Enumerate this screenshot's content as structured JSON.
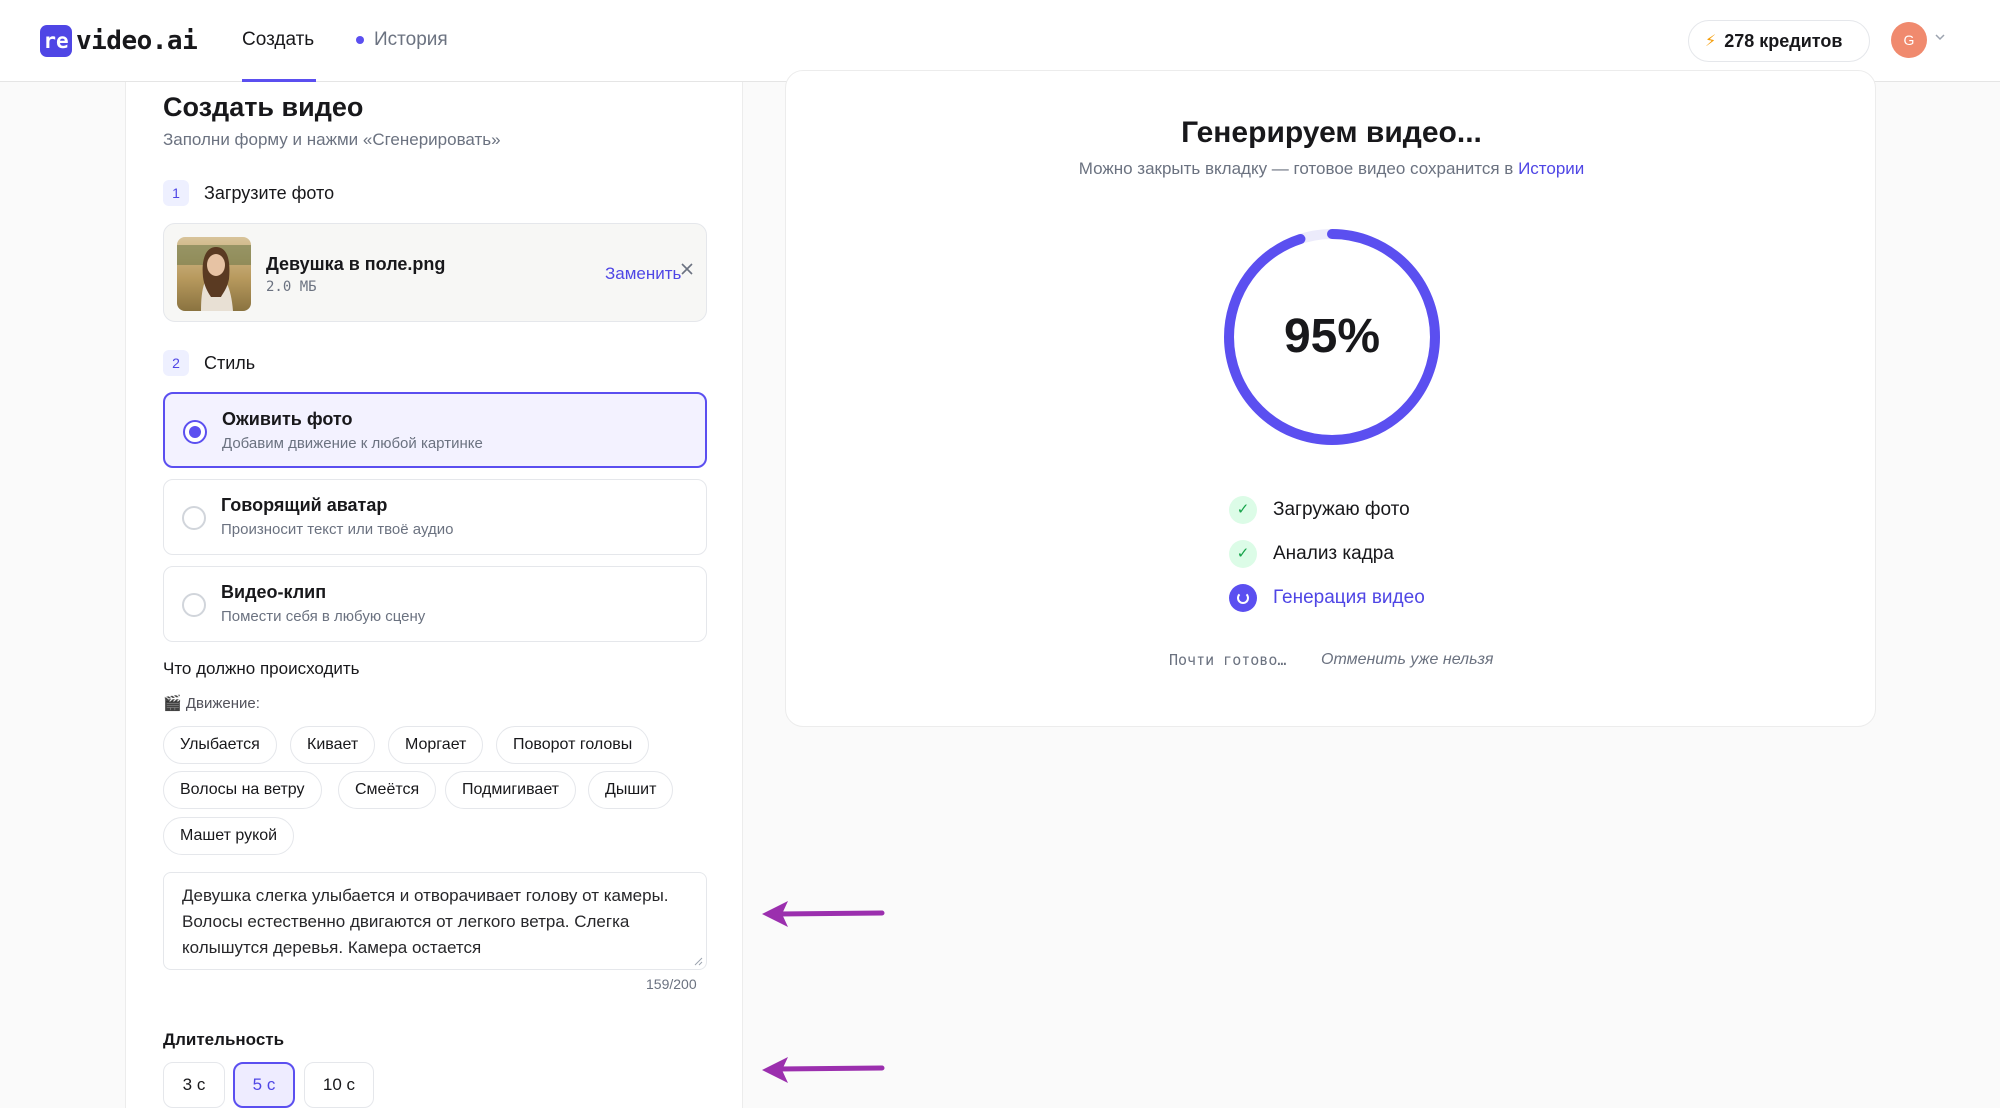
{
  "header": {
    "logo_mark": "re",
    "logo_text": "video.ai",
    "nav": [
      {
        "label": "Создать",
        "active": true
      },
      {
        "label": "История",
        "active": false
      }
    ],
    "credits": "278 кредитов",
    "avatar_initial": "G"
  },
  "form": {
    "title": "Создать видео",
    "subtitle": "Заполни форму и нажми «Сгенерировать»",
    "step1": {
      "number": "1",
      "label": "Загрузите фото"
    },
    "file": {
      "name": "Девушка в поле.png",
      "size": "2.0 МБ",
      "replace_label": "Заменить"
    },
    "step2": {
      "number": "2",
      "label": "Стиль"
    },
    "styles": [
      {
        "title": "Оживить фото",
        "desc": "Добавим движение к любой картинке",
        "selected": true
      },
      {
        "title": "Говорящий аватар",
        "desc": "Произносит текст или твоё аудио",
        "selected": false
      },
      {
        "title": "Видео-клип",
        "desc": "Помести себя в любую сцену",
        "selected": false
      }
    ],
    "prompt_label": "Что должно происходить",
    "motion_label": "🎬 Движение:",
    "chips": [
      "Улыбается",
      "Кивает",
      "Моргает",
      "Поворот головы",
      "Волосы на ветру",
      "Смеётся",
      "Подмигивает",
      "Дышит",
      "Машет рукой"
    ],
    "prompt_text": "Девушка слегка улыбается и отворачивает голову от камеры. Волосы естественно двигаются от легкого ветра. Слегка колышутся деревья. Камера остается",
    "counter": "159/200",
    "duration_label": "Длительность",
    "durations": [
      {
        "label": "3 с",
        "selected": false
      },
      {
        "label": "5 с",
        "selected": true
      },
      {
        "label": "10 с",
        "selected": false
      }
    ]
  },
  "progress": {
    "title": "Генерируем видео...",
    "subtitle_text": "Можно закрыть вкладку — готовое видео сохранится в ",
    "subtitle_link": "Истории",
    "percent_label": "95%",
    "percent_value": 0.95,
    "steps": [
      {
        "label": "Загружаю фото",
        "status": "done"
      },
      {
        "label": "Анализ кадра",
        "status": "done"
      },
      {
        "label": "Генерация видео",
        "status": "active"
      }
    ],
    "status_text": "Почти готово…",
    "cancel_text": "Отменить уже нельзя"
  },
  "colors": {
    "accent": "#5b4ff0",
    "accent_text": "#4f46e5",
    "success": "#16a34a",
    "annotation_arrow": "#9b2fae"
  }
}
